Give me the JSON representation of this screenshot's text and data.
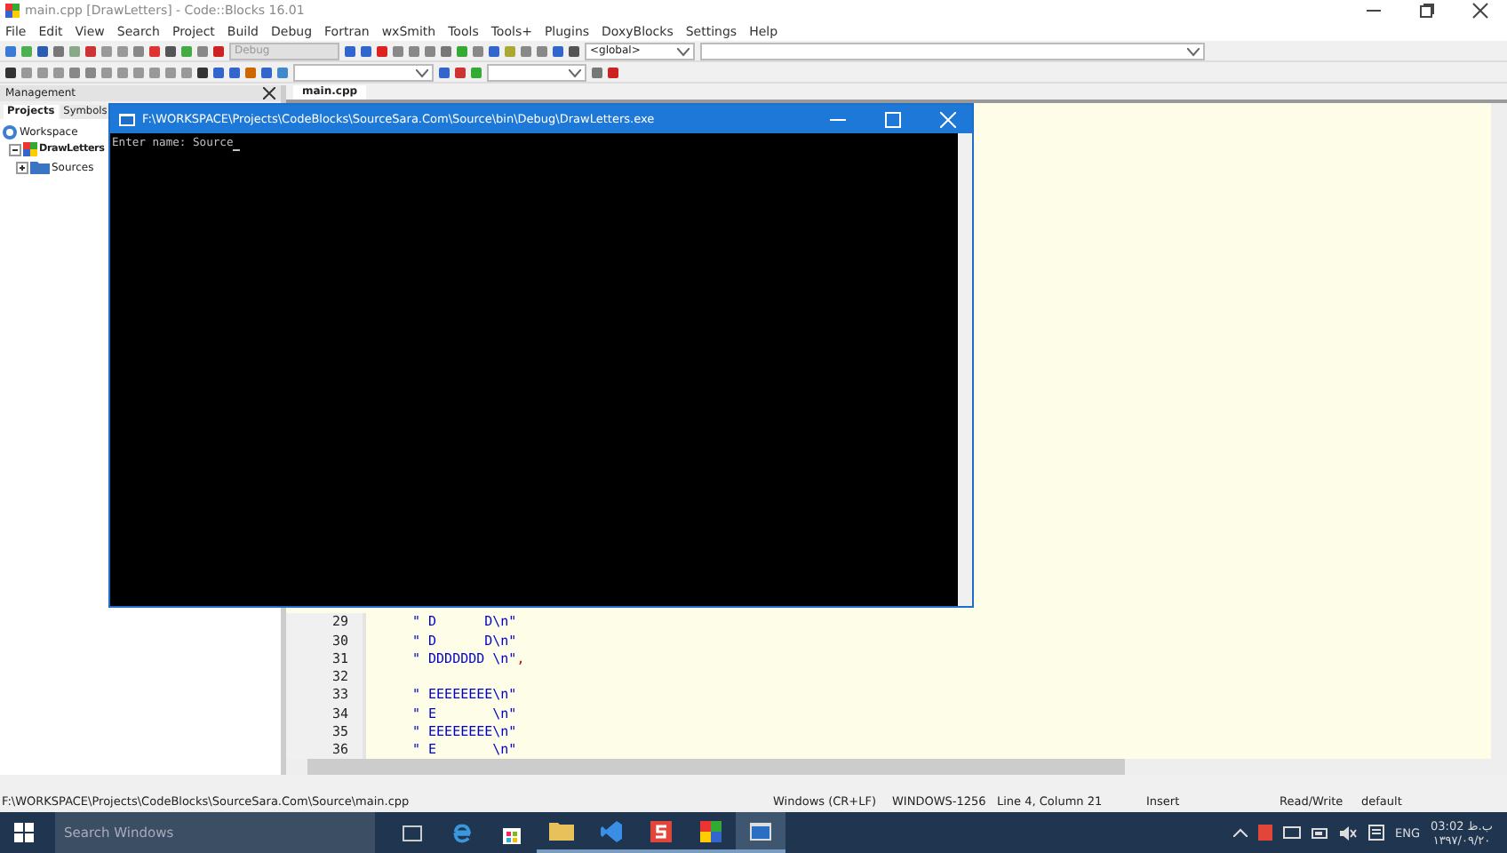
{
  "window": {
    "title": "main.cpp [DrawLetters] - Code::Blocks 16.01"
  },
  "menu": [
    "File",
    "Edit",
    "View",
    "Search",
    "Project",
    "Build",
    "Debug",
    "Fortran",
    "wxSmith",
    "Tools",
    "Tools+",
    "Plugins",
    "DoxyBlocks",
    "Settings",
    "Help"
  ],
  "toolbar": {
    "build_target": "Debug",
    "scope": "<global>"
  },
  "management": {
    "title": "Management",
    "tabs": [
      {
        "label": "Projects",
        "selected": true
      },
      {
        "label": "Symbols",
        "selected": false
      }
    ],
    "tree": [
      {
        "label": "Workspace",
        "kind": "workspace",
        "children": [
          {
            "label": "DrawLetters",
            "kind": "project",
            "expanded": true,
            "children": [
              {
                "label": "Sources",
                "kind": "folder",
                "expanded": false
              }
            ]
          }
        ]
      }
    ]
  },
  "editor": {
    "tabs": [
      {
        "label": "main.cpp",
        "selected": true
      }
    ],
    "lines": [
      {
        "number": "29",
        "segments": [
          {
            "text": "\" D      D\\n\"",
            "kind": "string"
          }
        ]
      },
      {
        "number": "30",
        "segments": [
          {
            "text": "\" D      D\\n\"",
            "kind": "string"
          }
        ]
      },
      {
        "number": "31",
        "segments": [
          {
            "text": "\" DDDDDDD \\n\"",
            "kind": "string"
          },
          {
            "text": ",",
            "kind": "operator"
          }
        ]
      },
      {
        "number": "32"
      },
      {
        "number": "33",
        "segments": [
          {
            "text": "\" EEEEEEEE\\n\"",
            "kind": "string"
          }
        ]
      },
      {
        "number": "34",
        "segments": [
          {
            "text": "\" E       \\n\"",
            "kind": "string"
          }
        ]
      },
      {
        "number": "35",
        "segments": [
          {
            "text": "\" EEEEEEEE\\n\"",
            "kind": "string"
          }
        ]
      },
      {
        "number": "36",
        "segments": [
          {
            "text": "\" E       \\n\"",
            "kind": "string"
          }
        ]
      }
    ]
  },
  "console": {
    "title": "F:\\WORKSPACE\\Projects\\CodeBlocks\\SourceSara.Com\\Source\\bin\\Debug\\DrawLetters.exe",
    "output": "Enter name: Source"
  },
  "status_bar": [
    "F:\\WORKSPACE\\Projects\\CodeBlocks\\SourceSara.Com\\Source\\main.cpp",
    "Windows (CR+LF)",
    "WINDOWS-1256",
    "Line 4, Column 21",
    "Insert",
    "Read/Write",
    "default"
  ],
  "taskbar": {
    "search": {
      "placeholder": "Search Windows"
    },
    "language": "ENG",
    "time": "03:02 ب.ظ",
    "date": "۱۳۹۷/۰۹/۲۰"
  }
}
